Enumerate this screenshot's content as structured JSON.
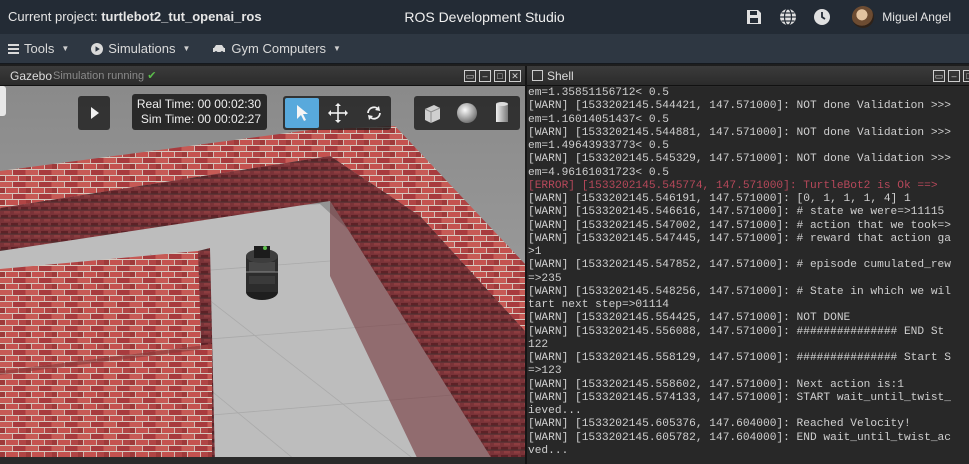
{
  "header": {
    "project_prefix": "Current project:",
    "project_name": "turtlebot2_tut_openai_ros",
    "title": "ROS Development Studio",
    "username": "Miguel Angel"
  },
  "menu": {
    "tools": "Tools",
    "simulations": "Simulations",
    "gym": "Gym Computers"
  },
  "gazebo": {
    "title": "Gazebo",
    "status": "Simulation running",
    "real_time_label": "Real Time:",
    "real_time": "00 00:02:30",
    "sim_time_label": "Sim Time:",
    "sim_time": "00 00:02:27"
  },
  "shell": {
    "title": "Shell",
    "lines": [
      {
        "t": "em=1.35851156712< 0.5",
        "c": ""
      },
      {
        "t": "[WARN] [1533202145.544421, 147.571000]: NOT done Validation >>>",
        "c": ""
      },
      {
        "t": "em=1.16014051437< 0.5",
        "c": ""
      },
      {
        "t": "[WARN] [1533202145.544881, 147.571000]: NOT done Validation >>>",
        "c": ""
      },
      {
        "t": "em=1.49643933773< 0.5",
        "c": ""
      },
      {
        "t": "[WARN] [1533202145.545329, 147.571000]: NOT done Validation >>>",
        "c": ""
      },
      {
        "t": "em=4.96161031723< 0.5",
        "c": ""
      },
      {
        "t": "[ERROR] [1533202145.545774, 147.571000]: TurtleBot2 is Ok ==>",
        "c": "err"
      },
      {
        "t": "[WARN] [1533202145.546191, 147.571000]: [0, 1, 1, 1, 4] 1",
        "c": ""
      },
      {
        "t": "[WARN] [1533202145.546616, 147.571000]: # state we were=>11115",
        "c": ""
      },
      {
        "t": "[WARN] [1533202145.547002, 147.571000]: # action that we took=>",
        "c": ""
      },
      {
        "t": "[WARN] [1533202145.547445, 147.571000]: # reward that action ga",
        "c": ""
      },
      {
        "t": ">1",
        "c": ""
      },
      {
        "t": "[WARN] [1533202145.547852, 147.571000]: # episode cumulated_rew",
        "c": ""
      },
      {
        "t": "=>235",
        "c": ""
      },
      {
        "t": "[WARN] [1533202145.548256, 147.571000]: # State in which we wil",
        "c": ""
      },
      {
        "t": "tart next step=>01114",
        "c": ""
      },
      {
        "t": "[WARN] [1533202145.554425, 147.571000]: NOT DONE",
        "c": ""
      },
      {
        "t": "[WARN] [1533202145.556088, 147.571000]: ############### END St",
        "c": ""
      },
      {
        "t": "122",
        "c": ""
      },
      {
        "t": "[WARN] [1533202145.558129, 147.571000]: ############### Start S",
        "c": ""
      },
      {
        "t": "=>123",
        "c": ""
      },
      {
        "t": "[WARN] [1533202145.558602, 147.571000]: Next action is:1",
        "c": ""
      },
      {
        "t": "[WARN] [1533202145.574133, 147.571000]: START wait_until_twist_",
        "c": ""
      },
      {
        "t": "ieved...",
        "c": ""
      },
      {
        "t": "[WARN] [1533202145.605376, 147.604000]: Reached Velocity!",
        "c": ""
      },
      {
        "t": "[WARN] [1533202145.605782, 147.604000]: END wait_until_twist_ac",
        "c": ""
      },
      {
        "t": "ved...",
        "c": ""
      }
    ]
  },
  "icons": {
    "save": "save-icon",
    "globe": "globe-icon",
    "clock": "clock-icon",
    "menu": "hamburger-icon",
    "play": "play-icon",
    "gym": "car-icon"
  }
}
